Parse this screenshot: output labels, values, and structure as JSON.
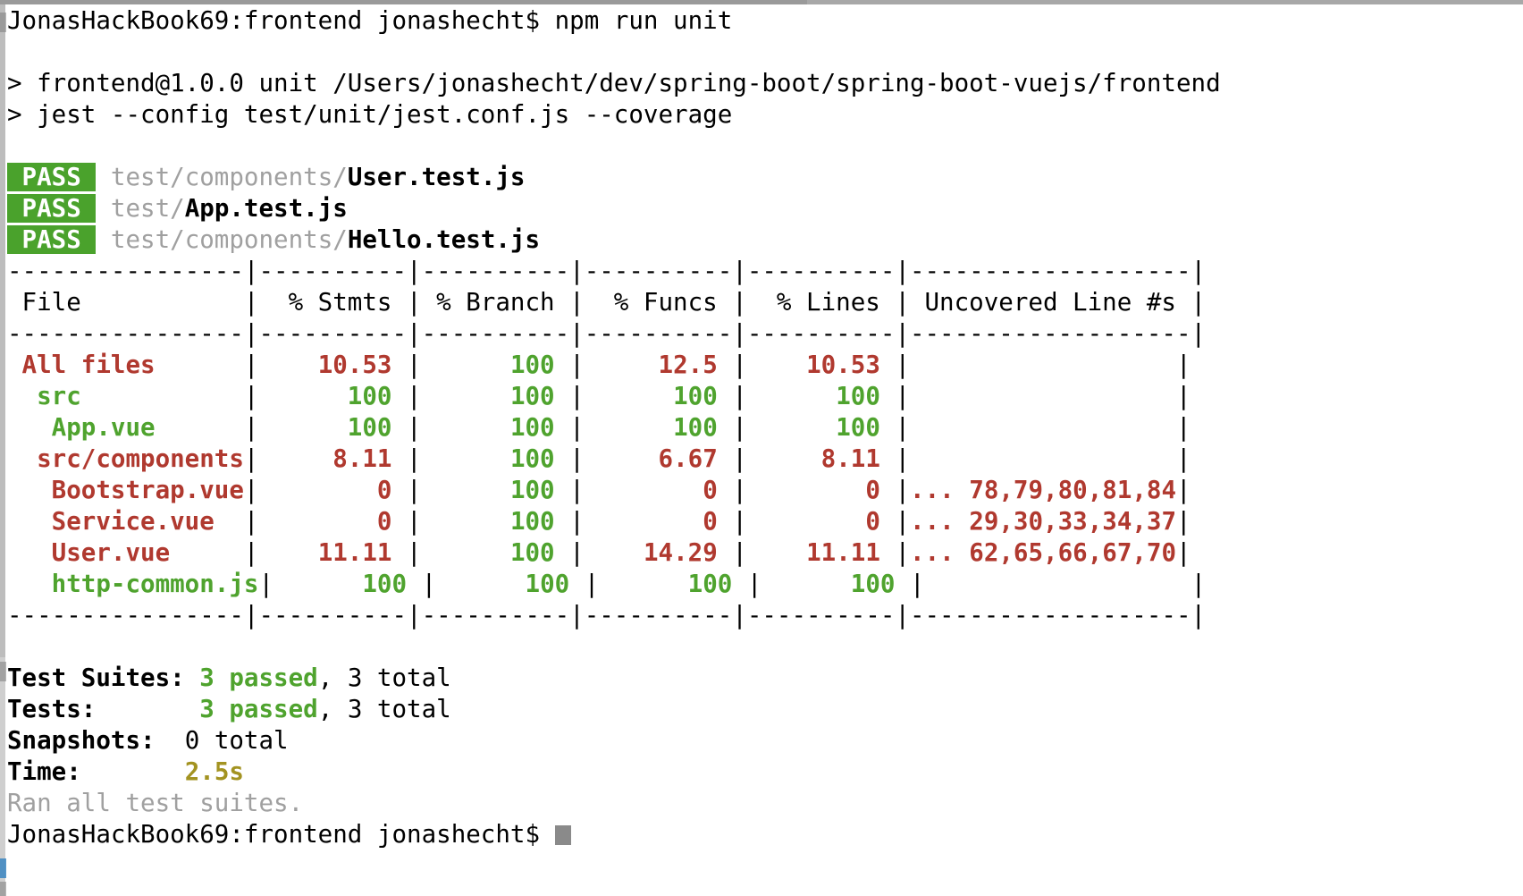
{
  "window": {
    "app": "Terminal",
    "shell_prompt": "JonasHackBook69:frontend jonashecht$"
  },
  "command_line": {
    "prompt": "JonasHackBook69:frontend jonashecht$",
    "command": " npm run unit"
  },
  "npm_output": {
    "line1": "> frontend@1.0.0 unit /Users/jonashecht/dev/spring-boot/spring-boot-vuejs/frontend",
    "line2": "> jest --config test/unit/jest.conf.js --coverage"
  },
  "suites": [
    {
      "status": "PASS",
      "dir": "test/components/",
      "file": "User.test.js"
    },
    {
      "status": "PASS",
      "dir": "test/",
      "file": "App.test.js"
    },
    {
      "status": "PASS",
      "dir": "test/components/",
      "file": "Hello.test.js"
    }
  ],
  "coverage_table": {
    "rule_top": "----------------|----------|----------|----------|----------|-------------------|",
    "rule_mid": "----------------|----------|----------|----------|----------|-------------------|",
    "rule_bottom": "----------------|----------|----------|----------|----------|-------------------|",
    "headers": [
      "File",
      "% Stmts",
      "% Branch",
      "% Funcs",
      "% Lines",
      "Uncovered Line #s"
    ],
    "rows": [
      {
        "file": "All files",
        "indent": 0,
        "color": "red",
        "stmts": "10.53",
        "branch": "100",
        "funcs": "12.5",
        "lines": "10.53",
        "uncovered": "",
        "stmts_color": "red",
        "branch_color": "green",
        "funcs_color": "red",
        "lines_color": "red"
      },
      {
        "file": "src",
        "indent": 1,
        "color": "green",
        "stmts": "100",
        "branch": "100",
        "funcs": "100",
        "lines": "100",
        "uncovered": "",
        "stmts_color": "green",
        "branch_color": "green",
        "funcs_color": "green",
        "lines_color": "green"
      },
      {
        "file": "App.vue",
        "indent": 2,
        "color": "green",
        "stmts": "100",
        "branch": "100",
        "funcs": "100",
        "lines": "100",
        "uncovered": "",
        "stmts_color": "green",
        "branch_color": "green",
        "funcs_color": "green",
        "lines_color": "green"
      },
      {
        "file": "src/components",
        "indent": 1,
        "color": "red",
        "stmts": "8.11",
        "branch": "100",
        "funcs": "6.67",
        "lines": "8.11",
        "uncovered": "",
        "stmts_color": "red",
        "branch_color": "green",
        "funcs_color": "red",
        "lines_color": "red"
      },
      {
        "file": "Bootstrap.vue",
        "indent": 2,
        "color": "red",
        "stmts": "0",
        "branch": "100",
        "funcs": "0",
        "lines": "0",
        "uncovered": "... 78,79,80,81,84",
        "stmts_color": "red",
        "branch_color": "green",
        "funcs_color": "red",
        "lines_color": "red"
      },
      {
        "file": "Service.vue",
        "indent": 2,
        "color": "red",
        "stmts": "0",
        "branch": "100",
        "funcs": "0",
        "lines": "0",
        "uncovered": "... 29,30,33,34,37",
        "stmts_color": "red",
        "branch_color": "green",
        "funcs_color": "red",
        "lines_color": "red"
      },
      {
        "file": "User.vue",
        "indent": 2,
        "color": "red",
        "stmts": "11.11",
        "branch": "100",
        "funcs": "14.29",
        "lines": "11.11",
        "uncovered": "... 62,65,66,67,70",
        "stmts_color": "red",
        "branch_color": "green",
        "funcs_color": "red",
        "lines_color": "red"
      },
      {
        "file": "http-common.js",
        "indent": 2,
        "color": "green",
        "stmts": "100",
        "branch": "100",
        "funcs": "100",
        "lines": "100",
        "uncovered": "",
        "stmts_color": "green",
        "branch_color": "green",
        "funcs_color": "green",
        "lines_color": "green"
      }
    ]
  },
  "summary": {
    "test_suites_label": "Test Suites:",
    "test_suites_passed": "3 passed",
    "test_suites_rest": ", 3 total",
    "tests_label": "Tests:",
    "tests_passed": "3 passed",
    "tests_rest": ", 3 total",
    "snapshots_label": "Snapshots:",
    "snapshots_value": "0 total",
    "time_label": "Time:",
    "time_value": "2.5s",
    "ran_all": "Ran all test suites."
  },
  "final_prompt": {
    "text": "JonasHackBook69:frontend jonashecht$"
  },
  "colors": {
    "pass_badge_bg": "#4aa22c",
    "green": "#4fa32e",
    "red": "#b0392f",
    "olive": "#a39321",
    "dim": "#a0a0a0",
    "background": "#ffffff",
    "foreground": "#000000"
  }
}
